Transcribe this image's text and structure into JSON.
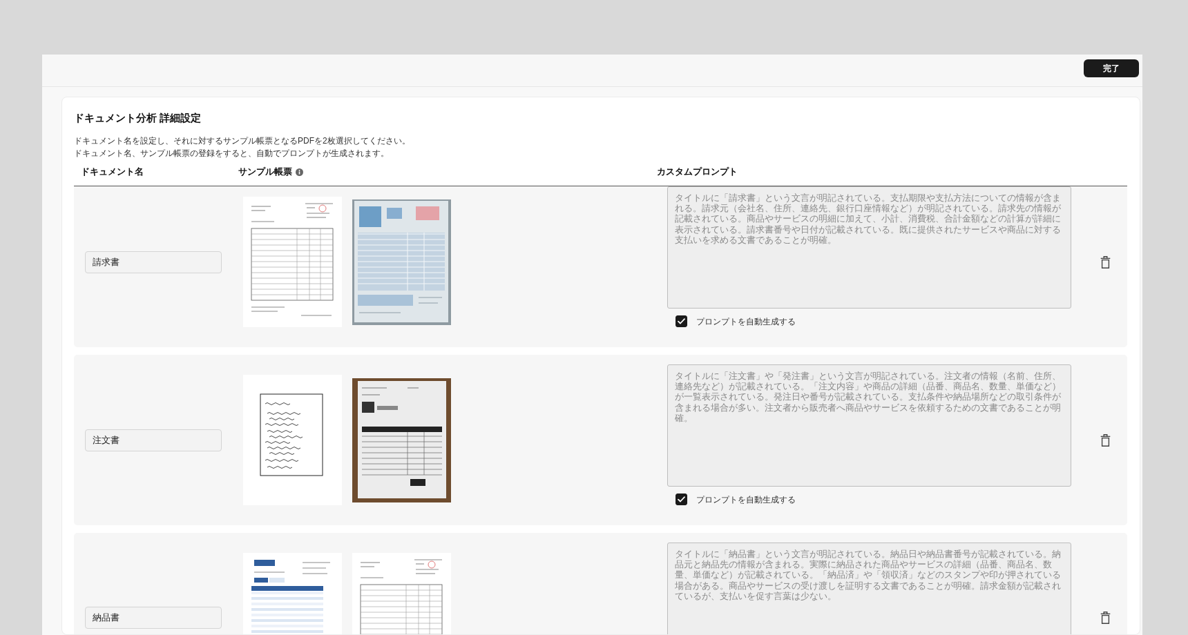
{
  "header": {
    "done_button": "完了"
  },
  "settings": {
    "title": "ドキュメント分析 詳細設定",
    "description": [
      "ドキュメント名を設定し、それに対するサンプル帳票となるPDFを2枚選択してください。",
      "ドキュメント名、サンプル帳票の登録をすると、自動でプロンプトが生成されます。"
    ],
    "columns": [
      {
        "label": "ドキュメント名",
        "info": false
      },
      {
        "label": "サンプル帳票",
        "info": true
      },
      {
        "label": "カスタムプロンプト",
        "info": false
      }
    ],
    "rows": [
      {
        "name": "請求書",
        "samples": [
          {
            "kind": "scan"
          },
          {
            "kind": "photo"
          }
        ],
        "prompt": {
          "text": "タイトルに「請求書」という文言が明記されている。支払期限や支払方法についての情報が含まれる。請求元（会社名、住所、連絡先、銀行口座情報など）が明記されている。請求先の情報が記載されている。商品やサービスの明細に加えて、小計、消費税、合計金額などの計算が詳細に表示されている。請求書番号や日付が記載されている。既に提供されたサービスや商品に対する支払いを求める文書であることが明確。",
          "disabled": true
        },
        "auto_generate": {
          "label": "プロンプトを自動生成する",
          "checked": true
        }
      },
      {
        "name": "注文書",
        "samples": [
          {
            "kind": "handwritten"
          },
          {
            "kind": "photo_wood"
          }
        ],
        "prompt": {
          "text": "タイトルに「注文書」や「発注書」という文言が明記されている。注文者の情報（名前、住所、連絡先など）が記載されている。「注文内容」や商品の詳細（品番、商品名、数量、単価など）が一覧表示されている。発注日や番号が記載されている。支払条件や納品場所などの取引条件が含まれる場合が多い。注文者から販売者へ商品やサービスを依頼するための文書であることが明確。",
          "disabled": true
        },
        "auto_generate": {
          "label": "プロンプトを自動生成する",
          "checked": true
        }
      },
      {
        "name": "納品書",
        "samples": [
          {
            "kind": "blue_form"
          },
          {
            "kind": "scan"
          }
        ],
        "prompt": {
          "text": "タイトルに「納品書」という文言が明記されている。納品日や納品書番号が記載されている。納品元と納品先の情報が含まれる。実際に納品された商品やサービスの詳細（品番、商品名、数量、単価など）が記載されている。「納品済」や「領収済」などのスタンプや印が押されている場合がある。商品やサービスの受け渡しを証明する文書であることが明確。請求金額が記載されているが、支払いを促す言葉は少ない。",
          "disabled": true
        }
      }
    ]
  }
}
